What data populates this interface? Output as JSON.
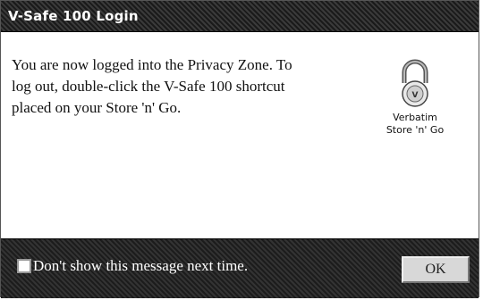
{
  "window": {
    "title": "V-Safe 100 Login"
  },
  "message": {
    "lines": [
      "You are now logged into the Privacy Zone. To",
      "log out, double-click the V-Safe 100 shortcut",
      "placed on your Store 'n' Go."
    ]
  },
  "logo": {
    "icon": "padlock-icon",
    "line1": "Verbatim",
    "line2": "Store 'n' Go"
  },
  "footer": {
    "checkbox_label": "Don't show this message next time.",
    "checkbox_checked": false,
    "ok_label": "OK"
  }
}
